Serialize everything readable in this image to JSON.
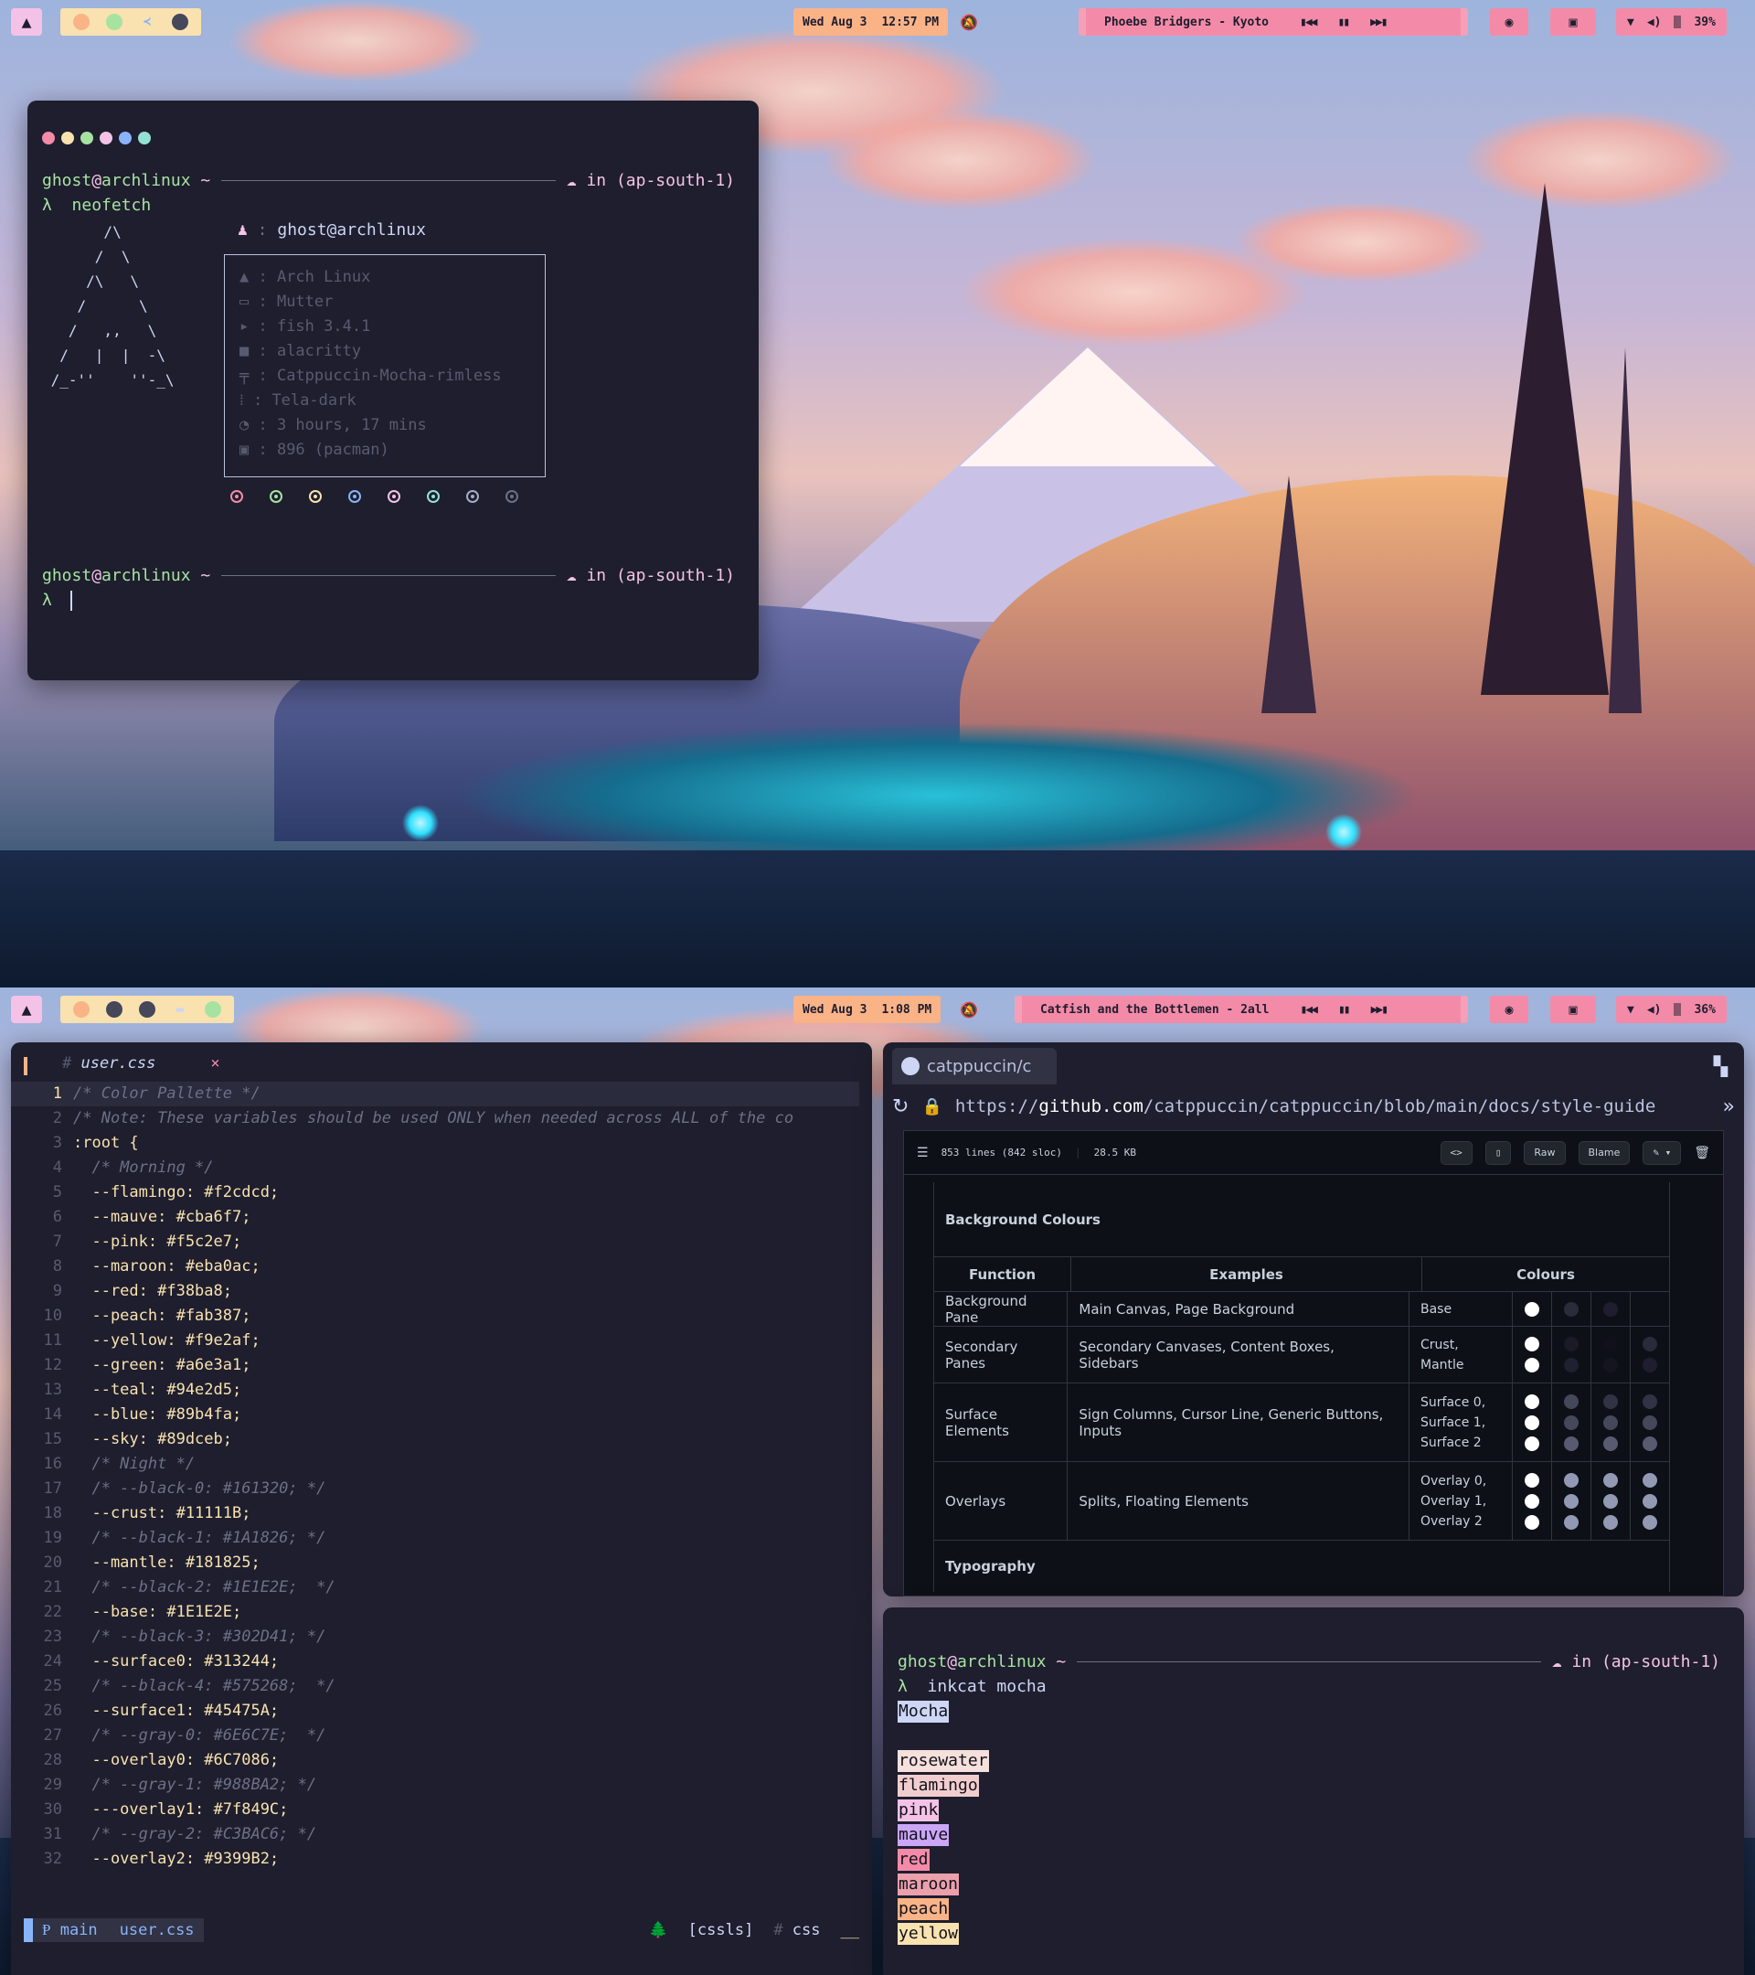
{
  "colors": {
    "base": "#1e1e2e",
    "rosewater": "#f5e0dc",
    "flamingo": "#f2cdcd",
    "pink": "#f5c2e7",
    "mauve": "#cba6f7",
    "red": "#f38ba8",
    "maroon": "#eba0ac",
    "peach": "#fab387",
    "yellow": "#f9e2af",
    "green": "#a6e3a1",
    "teal": "#94e2d5",
    "sky": "#89dceb",
    "blue": "#89b4fa",
    "overlay": "#6c7086"
  },
  "top_bar": {
    "launcher_icon": "arch-logo-icon",
    "apps": [
      "firefox-icon",
      "spotify-icon",
      "vscode-icon",
      "arch-icon"
    ],
    "date": "Wed Aug 3",
    "time": "12:57 PM",
    "now_playing": "Phoebe Bridgers - Kyoto",
    "controls": [
      "⏮",
      "⏸",
      "⏭"
    ],
    "battery": "39%"
  },
  "bottom_bar": {
    "apps": [
      "firefox-icon",
      "arch-icon",
      "arch-icon",
      "files-icon",
      "spotify-icon"
    ],
    "date": "Wed Aug 3",
    "time": "1:08 PM",
    "now_playing": "Catfish and the Bottlemen - 2all",
    "battery": "36%"
  },
  "neofetch_term": {
    "user": "ghost",
    "at": "@",
    "host": "archlinux",
    "dir": "~",
    "region": "in (ap-south-1)",
    "prompt_symbol": "λ",
    "command": "neofetch",
    "ascii": "       /\\\n      /  \\\n     /\\   \\\n    /      \\\n   /   ,,   \\\n  /   |  |  -\\\n /_-''    ''-_\\",
    "title": "ghost@archlinux",
    "info": [
      {
        "icon": "arch-icon",
        "value": "Arch Linux"
      },
      {
        "icon": "window-icon",
        "value": "Mutter"
      },
      {
        "icon": "shell-icon",
        "value": "fish 3.4.1"
      },
      {
        "icon": "terminal-icon",
        "value": "alacritty"
      },
      {
        "icon": "paint-icon",
        "value": "Catppuccin-Mocha-rimless"
      },
      {
        "icon": "grid-icon",
        "value": "Tela-dark"
      },
      {
        "icon": "clock-icon",
        "value": "3 hours, 17 mins"
      },
      {
        "icon": "package-icon",
        "value": "896 (pacman)"
      }
    ]
  },
  "editor": {
    "tab": "user.css",
    "tab_close": "×",
    "lines": [
      {
        "n": "1",
        "t": "/* Color Pallette */"
      },
      {
        "n": "2",
        "t": "/* Note: These variables should be used ONLY when needed across ALL of the co"
      },
      {
        "n": "3",
        "t": ":root {"
      },
      {
        "n": "4",
        "t": "  /* Morning */"
      },
      {
        "n": "5",
        "t": "  --flamingo: #f2cdcd;"
      },
      {
        "n": "6",
        "t": "  --mauve: #cba6f7;"
      },
      {
        "n": "7",
        "t": "  --pink: #f5c2e7;"
      },
      {
        "n": "8",
        "t": "  --maroon: #eba0ac;"
      },
      {
        "n": "9",
        "t": "  --red: #f38ba8;"
      },
      {
        "n": "10",
        "t": "  --peach: #fab387;"
      },
      {
        "n": "11",
        "t": "  --yellow: #f9e2af;"
      },
      {
        "n": "12",
        "t": "  --green: #a6e3a1;"
      },
      {
        "n": "13",
        "t": "  --teal: #94e2d5;"
      },
      {
        "n": "14",
        "t": "  --blue: #89b4fa;"
      },
      {
        "n": "15",
        "t": "  --sky: #89dceb;"
      },
      {
        "n": "16",
        "t": "  /* Night */"
      },
      {
        "n": "17",
        "t": "  /* --black-0: #161320; */"
      },
      {
        "n": "18",
        "t": "  --crust: #11111B;"
      },
      {
        "n": "19",
        "t": "  /* --black-1: #1A1826; */"
      },
      {
        "n": "20",
        "t": "  --mantle: #181825;"
      },
      {
        "n": "21",
        "t": "  /* --black-2: #1E1E2E;  */"
      },
      {
        "n": "22",
        "t": "  --base: #1E1E2E;"
      },
      {
        "n": "23",
        "t": "  /* --black-3: #302D41; */"
      },
      {
        "n": "24",
        "t": "  --surface0: #313244;"
      },
      {
        "n": "25",
        "t": "  /* --black-4: #575268;  */"
      },
      {
        "n": "26",
        "t": "  --surface1: #45475A;"
      },
      {
        "n": "27",
        "t": "  /* --gray-0: #6E6C7E;  */"
      },
      {
        "n": "28",
        "t": "  --overlay0: #6C7086;"
      },
      {
        "n": "29",
        "t": "  /* --gray-1: #988BA2; */"
      },
      {
        "n": "30",
        "t": "  ---overlay1: #7f849C;"
      },
      {
        "n": "31",
        "t": "  /* --gray-2: #C3BAC6; */"
      },
      {
        "n": "32",
        "t": "  --overlay2: #9399B2;"
      }
    ],
    "status": {
      "branch_icon": "git-branch-icon",
      "branch": "main",
      "file": "user.css",
      "lsp": "[cssls]",
      "lang": "css"
    }
  },
  "browser": {
    "tab": "catppuccin/c",
    "url_prefix": "https://",
    "url_host": "github.com",
    "url_path": "/catppuccin/catppuccin/blob/main/docs/style-guide",
    "file_info": "853 lines (842 sloc)",
    "file_size": "28.5 KB",
    "buttons": {
      "raw": "Raw",
      "blame": "Blame"
    },
    "section": "Background Colours",
    "headers": [
      "Function",
      "Examples",
      "Colours"
    ],
    "rows": [
      {
        "fn": "Background Pane",
        "ex": "Main Canvas, Page Background",
        "col": "Base",
        "swatches": [
          [
            "#ffffff"
          ],
          [
            "#2b2c3a"
          ],
          [
            "#1e1e2e"
          ],
          [
            "#0d1117"
          ]
        ]
      },
      {
        "fn": "Secondary Panes",
        "ex": "Secondary Canvases, Content Boxes, Sidebars",
        "col": "Crust, Mantle",
        "swatches": [
          [
            "#ffffff",
            "#ffffff"
          ],
          [
            "#1a1b26",
            "#1f2030"
          ],
          [
            "#11111b",
            "#151520"
          ],
          [
            "#2a2b3a",
            "#1e1e2e"
          ]
        ]
      },
      {
        "fn": "Surface Elements",
        "ex": "Sign Columns, Cursor Line, Generic Buttons, Inputs",
        "col": "Surface 0, Surface 1, Surface 2",
        "swatches": [
          [
            "#ffffff",
            "#ffffff",
            "#ffffff"
          ],
          [
            "#45475a",
            "#45475a",
            "#585b70"
          ],
          [
            "#313244",
            "#45475a",
            "#585b70"
          ],
          [
            "#313244",
            "#45475a",
            "#585b70"
          ]
        ]
      },
      {
        "fn": "Overlays",
        "ex": "Splits, Floating Elements",
        "col": "Overlay 0, Overlay 1, Overlay 2",
        "swatches": [
          [
            "#ffffff",
            "#ffffff",
            "#ffffff"
          ],
          [
            "#9399b2",
            "#9399b2",
            "#9399b2"
          ],
          [
            "#9399b2",
            "#9399b2",
            "#9399b2"
          ],
          [
            "#9399b2",
            "#9399b2",
            "#9399b2"
          ]
        ]
      }
    ],
    "next_section": "Typography"
  },
  "inkcat_term": {
    "user": "ghost",
    "at": "@",
    "host": "archlinux",
    "dir": "~",
    "region": "in (ap-south-1)",
    "prompt_symbol": "λ",
    "command": "inkcat mocha",
    "heading": "Mocha",
    "items": [
      {
        "name": "rosewater",
        "color": "#f5e0dc"
      },
      {
        "name": "flamingo",
        "color": "#f2cdcd"
      },
      {
        "name": "pink",
        "color": "#f5c2e7"
      },
      {
        "name": "mauve",
        "color": "#cba6f7"
      },
      {
        "name": "red",
        "color": "#f38ba8"
      },
      {
        "name": "maroon",
        "color": "#eba0ac"
      },
      {
        "name": "peach",
        "color": "#fab387"
      },
      {
        "name": "yellow",
        "color": "#f9e2af"
      }
    ]
  }
}
